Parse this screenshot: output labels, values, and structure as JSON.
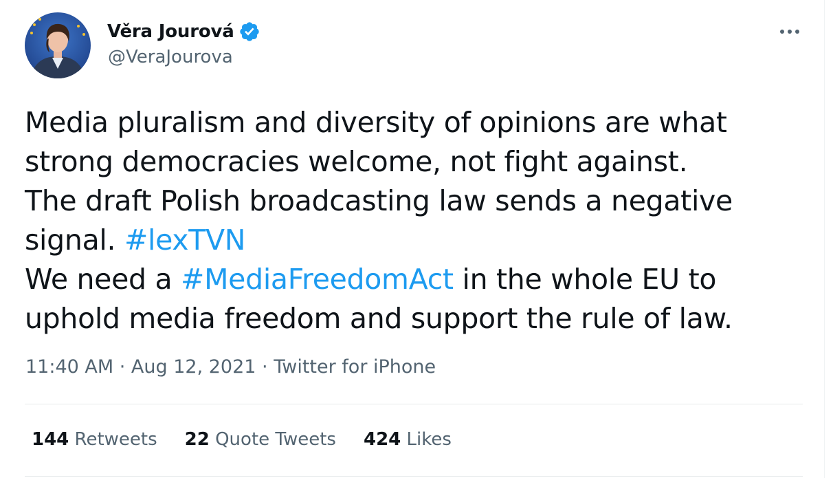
{
  "author": {
    "display_name": "Věra Jourová",
    "handle": "@VeraJourova",
    "verified": true,
    "verified_icon": "verified-badge-icon",
    "verified_color": "#1d9bf0",
    "avatar_icon": "profile-avatar"
  },
  "more_icon": "more-horizontal-icon",
  "tweet": {
    "lines": [
      [
        {
          "t": "Media pluralism and diversity of opinions are what"
        }
      ],
      [
        {
          "t": "strong democracies welcome, not fight against."
        }
      ],
      [
        {
          "t": "The draft Polish broadcasting law sends a negative"
        }
      ],
      [
        {
          "t": "signal. "
        },
        {
          "t": "#lexTVN",
          "tag": true
        }
      ],
      [
        {
          "t": "We need a "
        },
        {
          "t": "#MediaFreedomAct",
          "tag": true
        },
        {
          "t": " in the whole EU to"
        }
      ],
      [
        {
          "t": "uphold media freedom and support the rule of law."
        }
      ]
    ],
    "link_color": "#1d9bf0"
  },
  "meta": {
    "time": "11:40 AM",
    "separator": " · ",
    "date": "Aug 12, 2021",
    "source": "Twitter for iPhone"
  },
  "stats": {
    "retweets": {
      "value": "144",
      "label": "Retweets"
    },
    "quotes": {
      "value": "22",
      "label": "Quote Tweets"
    },
    "likes": {
      "value": "424",
      "label": "Likes"
    }
  }
}
